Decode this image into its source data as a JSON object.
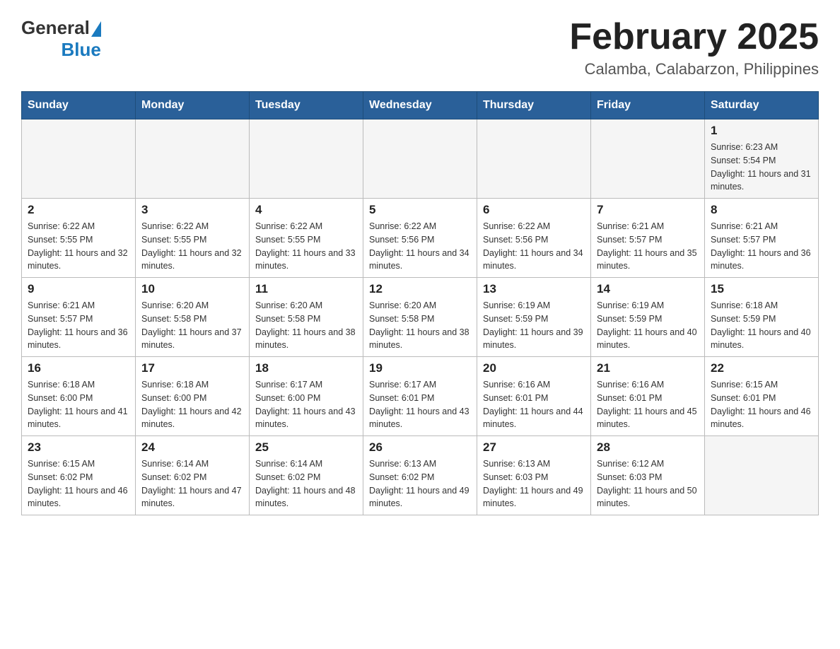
{
  "header": {
    "logo_general": "General",
    "logo_blue": "Blue",
    "main_title": "February 2025",
    "subtitle": "Calamba, Calabarzon, Philippines"
  },
  "days_of_week": [
    "Sunday",
    "Monday",
    "Tuesday",
    "Wednesday",
    "Thursday",
    "Friday",
    "Saturday"
  ],
  "weeks": [
    [
      {
        "day": "",
        "info": ""
      },
      {
        "day": "",
        "info": ""
      },
      {
        "day": "",
        "info": ""
      },
      {
        "day": "",
        "info": ""
      },
      {
        "day": "",
        "info": ""
      },
      {
        "day": "",
        "info": ""
      },
      {
        "day": "1",
        "info": "Sunrise: 6:23 AM\nSunset: 5:54 PM\nDaylight: 11 hours and 31 minutes."
      }
    ],
    [
      {
        "day": "2",
        "info": "Sunrise: 6:22 AM\nSunset: 5:55 PM\nDaylight: 11 hours and 32 minutes."
      },
      {
        "day": "3",
        "info": "Sunrise: 6:22 AM\nSunset: 5:55 PM\nDaylight: 11 hours and 32 minutes."
      },
      {
        "day": "4",
        "info": "Sunrise: 6:22 AM\nSunset: 5:55 PM\nDaylight: 11 hours and 33 minutes."
      },
      {
        "day": "5",
        "info": "Sunrise: 6:22 AM\nSunset: 5:56 PM\nDaylight: 11 hours and 34 minutes."
      },
      {
        "day": "6",
        "info": "Sunrise: 6:22 AM\nSunset: 5:56 PM\nDaylight: 11 hours and 34 minutes."
      },
      {
        "day": "7",
        "info": "Sunrise: 6:21 AM\nSunset: 5:57 PM\nDaylight: 11 hours and 35 minutes."
      },
      {
        "day": "8",
        "info": "Sunrise: 6:21 AM\nSunset: 5:57 PM\nDaylight: 11 hours and 36 minutes."
      }
    ],
    [
      {
        "day": "9",
        "info": "Sunrise: 6:21 AM\nSunset: 5:57 PM\nDaylight: 11 hours and 36 minutes."
      },
      {
        "day": "10",
        "info": "Sunrise: 6:20 AM\nSunset: 5:58 PM\nDaylight: 11 hours and 37 minutes."
      },
      {
        "day": "11",
        "info": "Sunrise: 6:20 AM\nSunset: 5:58 PM\nDaylight: 11 hours and 38 minutes."
      },
      {
        "day": "12",
        "info": "Sunrise: 6:20 AM\nSunset: 5:58 PM\nDaylight: 11 hours and 38 minutes."
      },
      {
        "day": "13",
        "info": "Sunrise: 6:19 AM\nSunset: 5:59 PM\nDaylight: 11 hours and 39 minutes."
      },
      {
        "day": "14",
        "info": "Sunrise: 6:19 AM\nSunset: 5:59 PM\nDaylight: 11 hours and 40 minutes."
      },
      {
        "day": "15",
        "info": "Sunrise: 6:18 AM\nSunset: 5:59 PM\nDaylight: 11 hours and 40 minutes."
      }
    ],
    [
      {
        "day": "16",
        "info": "Sunrise: 6:18 AM\nSunset: 6:00 PM\nDaylight: 11 hours and 41 minutes."
      },
      {
        "day": "17",
        "info": "Sunrise: 6:18 AM\nSunset: 6:00 PM\nDaylight: 11 hours and 42 minutes."
      },
      {
        "day": "18",
        "info": "Sunrise: 6:17 AM\nSunset: 6:00 PM\nDaylight: 11 hours and 43 minutes."
      },
      {
        "day": "19",
        "info": "Sunrise: 6:17 AM\nSunset: 6:01 PM\nDaylight: 11 hours and 43 minutes."
      },
      {
        "day": "20",
        "info": "Sunrise: 6:16 AM\nSunset: 6:01 PM\nDaylight: 11 hours and 44 minutes."
      },
      {
        "day": "21",
        "info": "Sunrise: 6:16 AM\nSunset: 6:01 PM\nDaylight: 11 hours and 45 minutes."
      },
      {
        "day": "22",
        "info": "Sunrise: 6:15 AM\nSunset: 6:01 PM\nDaylight: 11 hours and 46 minutes."
      }
    ],
    [
      {
        "day": "23",
        "info": "Sunrise: 6:15 AM\nSunset: 6:02 PM\nDaylight: 11 hours and 46 minutes."
      },
      {
        "day": "24",
        "info": "Sunrise: 6:14 AM\nSunset: 6:02 PM\nDaylight: 11 hours and 47 minutes."
      },
      {
        "day": "25",
        "info": "Sunrise: 6:14 AM\nSunset: 6:02 PM\nDaylight: 11 hours and 48 minutes."
      },
      {
        "day": "26",
        "info": "Sunrise: 6:13 AM\nSunset: 6:02 PM\nDaylight: 11 hours and 49 minutes."
      },
      {
        "day": "27",
        "info": "Sunrise: 6:13 AM\nSunset: 6:03 PM\nDaylight: 11 hours and 49 minutes."
      },
      {
        "day": "28",
        "info": "Sunrise: 6:12 AM\nSunset: 6:03 PM\nDaylight: 11 hours and 50 minutes."
      },
      {
        "day": "",
        "info": ""
      }
    ]
  ]
}
